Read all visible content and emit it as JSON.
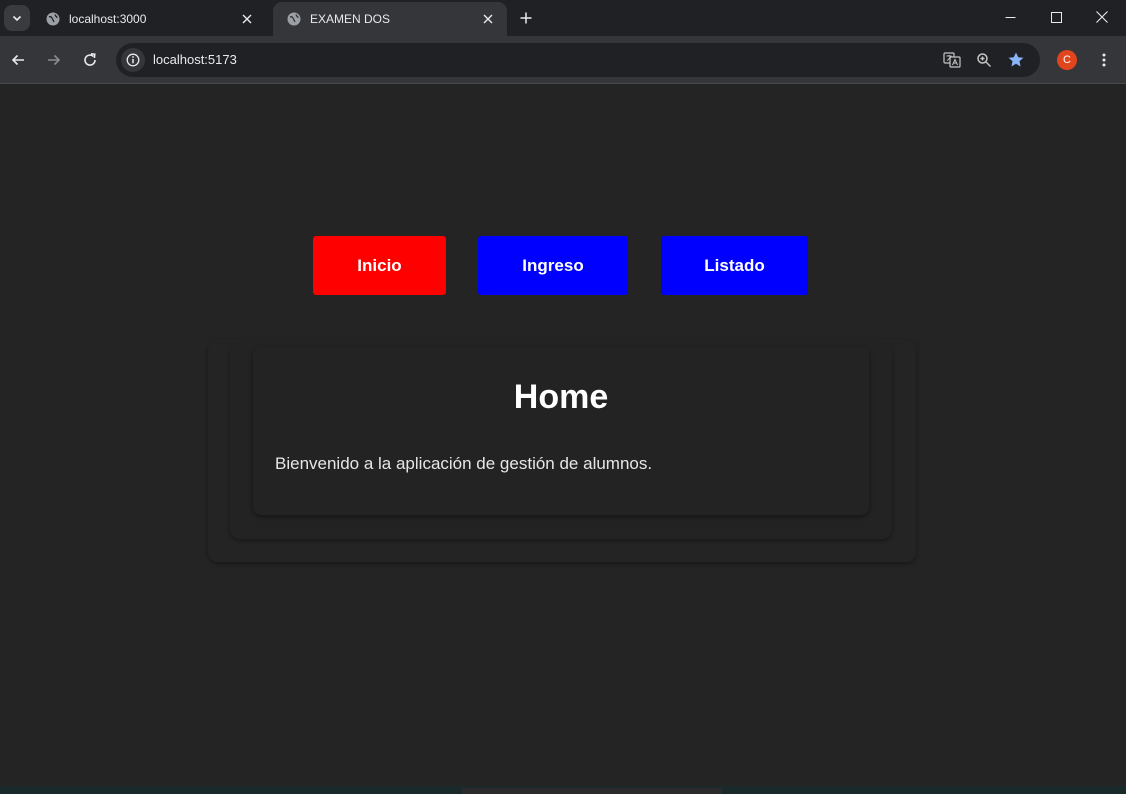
{
  "browser": {
    "tabs": [
      {
        "title": "localhost:3000",
        "active": false
      },
      {
        "title": "EXAMEN DOS",
        "active": true
      }
    ],
    "address": "localhost:5173",
    "profile_initial": "C",
    "icons": {
      "tab_search": "chevron-down-icon",
      "favicon": "globe-icon",
      "close": "close-icon",
      "new_tab": "plus-icon",
      "translate": "translate-icon",
      "zoom": "zoom-icon",
      "bookmark": "star-icon"
    }
  },
  "nav": {
    "inicio": "Inicio",
    "ingreso": "Ingreso",
    "listado": "Listado"
  },
  "colors": {
    "inicio_bg": "#ff0000",
    "nav_bg": "#0000ff",
    "page_bg": "#242424"
  },
  "content": {
    "title": "Home",
    "text": "Bienvenido a la aplicación de gestión de alumnos."
  }
}
